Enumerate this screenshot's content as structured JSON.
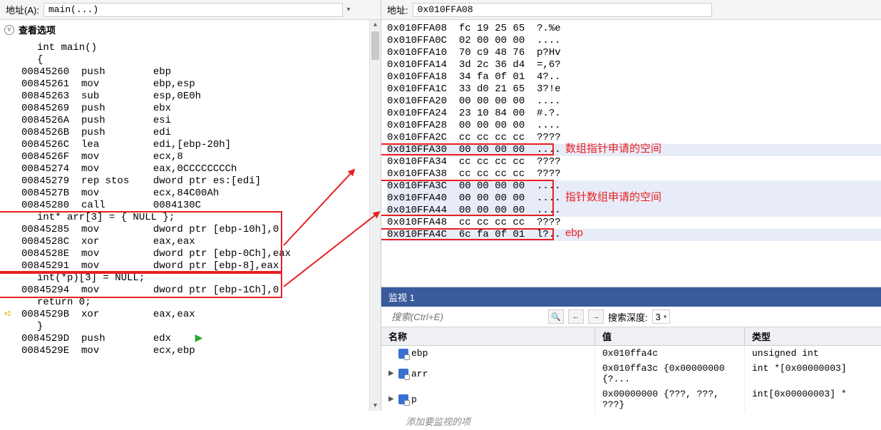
{
  "left": {
    "addr_label": "地址(A):",
    "addr_value": "main(...)",
    "collapse_label": "查看选项",
    "lines": [
      {
        "t": "int main()",
        "indent": true
      },
      {
        "t": "{",
        "indent": true
      },
      {
        "t": "00845260  push        ebp"
      },
      {
        "t": "00845261  mov         ebp,esp"
      },
      {
        "t": "00845263  sub         esp,0E0h"
      },
      {
        "t": "00845269  push        ebx"
      },
      {
        "t": "0084526A  push        esi"
      },
      {
        "t": "0084526B  push        edi"
      },
      {
        "t": "0084526C  lea         edi,[ebp-20h]"
      },
      {
        "t": "0084526F  mov         ecx,8"
      },
      {
        "t": "00845274  mov         eax,0CCCCCCCCh"
      },
      {
        "t": "00845279  rep stos    dword ptr es:[edi]"
      },
      {
        "t": "0084527B  mov         ecx,84C00Ah"
      },
      {
        "t": "00845280  call        0084130C"
      },
      {
        "t": "int* arr[3] = { NULL };",
        "indent": true
      },
      {
        "t": "00845285  mov         dword ptr [ebp-10h],0"
      },
      {
        "t": "0084528C  xor         eax,eax"
      },
      {
        "t": "0084528E  mov         dword ptr [ebp-0Ch],eax"
      },
      {
        "t": "00845291  mov         dword ptr [ebp-8],eax"
      },
      {
        "t": "int(*p)[3] = NULL;",
        "indent": true
      },
      {
        "t": "00845294  mov         dword ptr [ebp-1Ch],0"
      },
      {
        "t": "return 0;",
        "indent": true
      },
      {
        "t": "0084529B  xor         eax,eax",
        "arrow": true
      },
      {
        "t": "}",
        "indent": true
      },
      {
        "t": "0084529D  push        edx  ",
        "play": true
      },
      {
        "t": "0084529E  mov         ecx,ebp"
      }
    ]
  },
  "right": {
    "addr_label": "地址:",
    "addr_value": "0x010FFA08",
    "mem": [
      {
        "a": "0x010FFA08",
        "b": "fc 19 25 65",
        "c": "?.%e"
      },
      {
        "a": "0x010FFA0C",
        "b": "02 00 00 00",
        "c": "...."
      },
      {
        "a": "0x010FFA10",
        "b": "70 c9 48 76",
        "c": "p?Hv"
      },
      {
        "a": "0x010FFA14",
        "b": "3d 2c 36 d4",
        "c": "=,6?"
      },
      {
        "a": "0x010FFA18",
        "b": "34 fa 0f 01",
        "c": "4?.."
      },
      {
        "a": "0x010FFA1C",
        "b": "33 d0 21 65",
        "c": "3?!e"
      },
      {
        "a": "0x010FFA20",
        "b": "00 00 00 00",
        "c": "...."
      },
      {
        "a": "0x010FFA24",
        "b": "23 10 84 00",
        "c": "#.?."
      },
      {
        "a": "0x010FFA28",
        "b": "00 00 00 00",
        "c": "...."
      },
      {
        "a": "0x010FFA2C",
        "b": "cc cc cc cc",
        "c": "????"
      },
      {
        "a": "0x010FFA30",
        "b": "00 00 00 00",
        "c": "....",
        "hl": true
      },
      {
        "a": "0x010FFA34",
        "b": "cc cc cc cc",
        "c": "????"
      },
      {
        "a": "0x010FFA38",
        "b": "cc cc cc cc",
        "c": "????"
      },
      {
        "a": "0x010FFA3C",
        "b": "00 00 00 00",
        "c": "....",
        "hl": true
      },
      {
        "a": "0x010FFA40",
        "b": "00 00 00 00",
        "c": "....",
        "hl": true
      },
      {
        "a": "0x010FFA44",
        "b": "00 00 00 00",
        "c": "....",
        "hl": true
      },
      {
        "a": "0x010FFA48",
        "b": "cc cc cc cc",
        "c": "????"
      },
      {
        "a": "0x010FFA4C",
        "b": "6c fa 0f 01",
        "c": "l?..",
        "hl": true
      }
    ],
    "anno1": "数组指针申请的空间",
    "anno2": "指针数组申请的空间",
    "anno3": "ebp"
  },
  "watch": {
    "title": "监视 1",
    "search_ph": "搜索(Ctrl+E)",
    "depth_label": "搜索深度:",
    "depth_value": "3",
    "col_name": "名称",
    "col_value": "值",
    "col_type": "类型",
    "rows": [
      {
        "toggle": "",
        "name": "ebp",
        "value": "0x010ffa4c",
        "type": "unsigned int"
      },
      {
        "toggle": "▶",
        "name": "arr",
        "value": "0x010ffa3c {0x00000000 {?...",
        "type": "int *[0x00000003]"
      },
      {
        "toggle": "▶",
        "name": "p",
        "value": "0x00000000 {???, ???, ???}",
        "type": "int[0x00000003] *"
      }
    ],
    "placeholder": "添加要监视的项"
  }
}
